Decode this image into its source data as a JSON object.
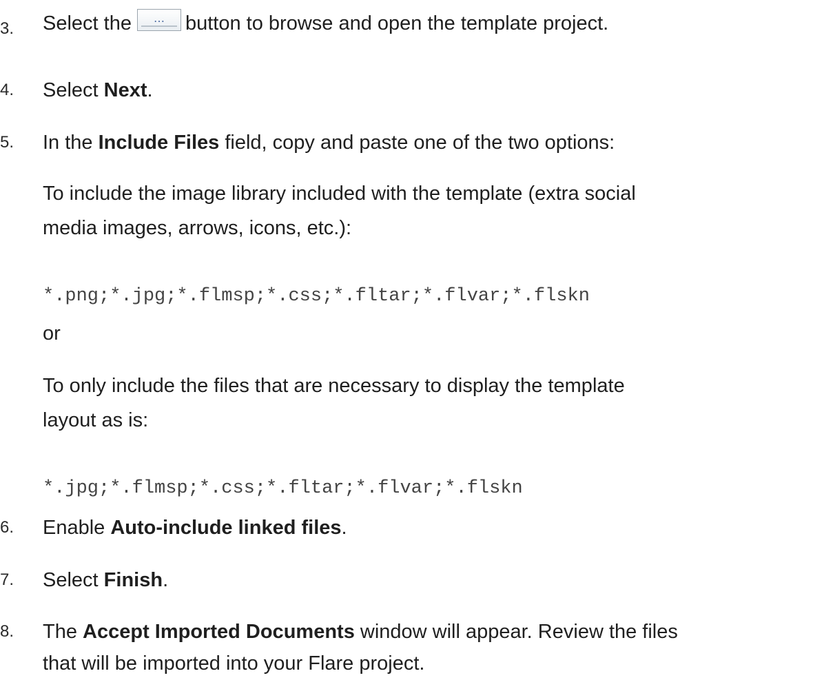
{
  "steps": {
    "s3": {
      "num": "3.",
      "pre": "Select the",
      "button_icon": "…",
      "post": "button to browse and open the template project."
    },
    "s4": {
      "num": "4.",
      "pre": "Select ",
      "bold": "Next",
      "post": "."
    },
    "s5": {
      "num": "5.",
      "pre": "In the ",
      "bold": "Include Files",
      "post": " field, copy and paste one of the two options:",
      "opt1_line1": "To include the image library included with the template (extra social",
      "opt1_line2": "media images, arrows, icons, etc.):",
      "code1": "*.png;*.jpg;*.flmsp;*.css;*.fltar;*.flvar;*.flskn",
      "or": "or",
      "opt2_line1": "To only include the files that are necessary to display the template",
      "opt2_line2": "layout as is:",
      "code2": "*.jpg;*.flmsp;*.css;*.fltar;*.flvar;*.flskn"
    },
    "s6": {
      "num": "6.",
      "pre": "Enable ",
      "bold": "Auto-include linked files",
      "post": "."
    },
    "s7": {
      "num": "7.",
      "pre": "Select ",
      "bold": "Finish",
      "post": "."
    },
    "s8": {
      "num": "8.",
      "pre": "The ",
      "bold": "Accept Imported Documents",
      "post": " window will appear. Review the files",
      "line2": "that will be imported into your Flare project."
    }
  }
}
